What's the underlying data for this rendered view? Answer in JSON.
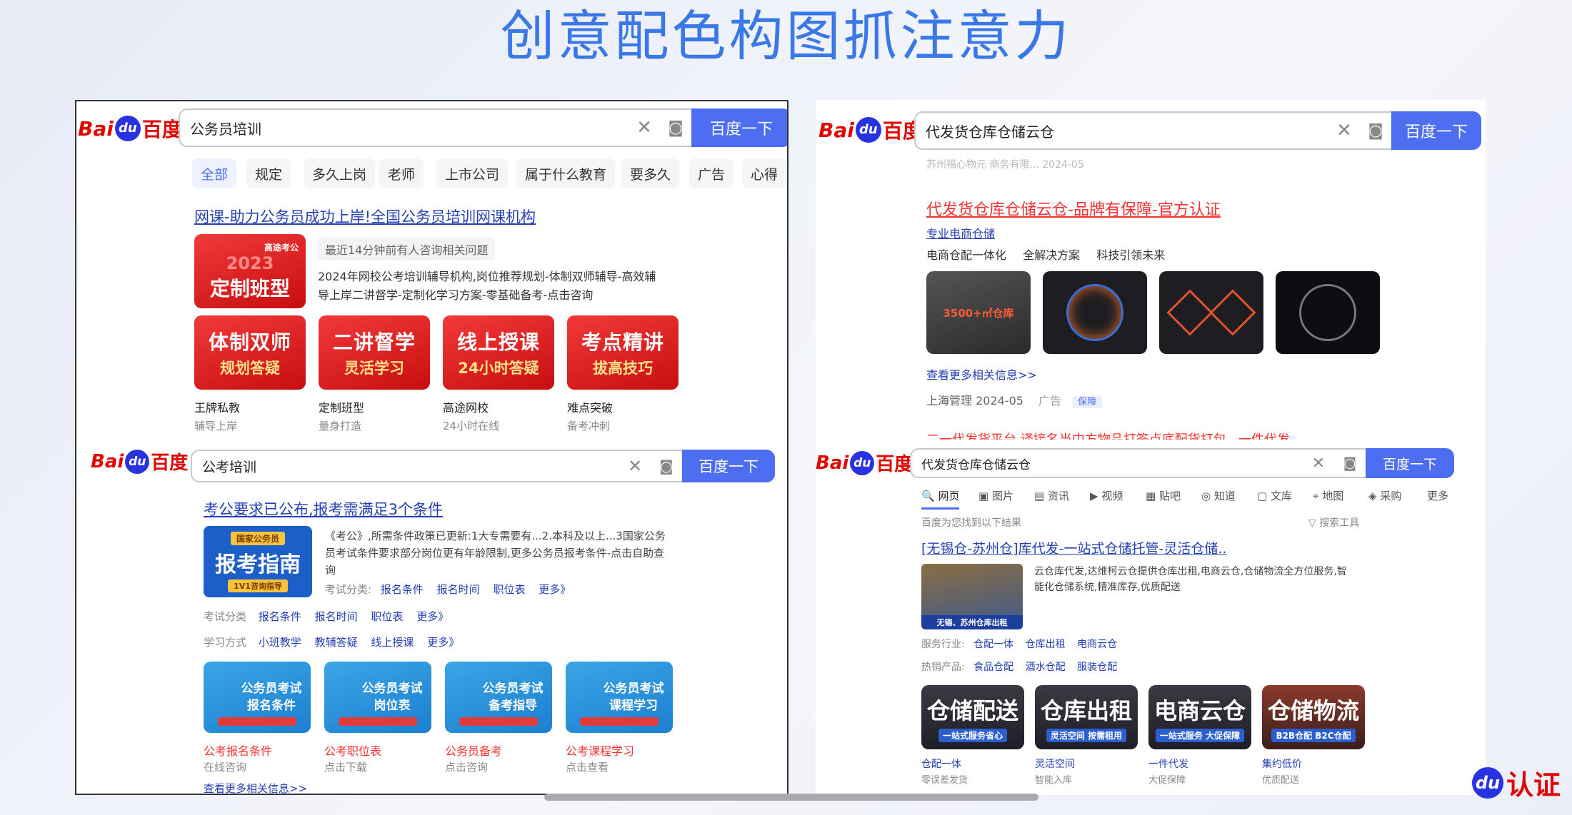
{
  "slide": {
    "title": "创意配色构图抓注意力",
    "watermark": "认证"
  },
  "brand": {
    "bai": "Bai",
    "du": "du",
    "baidu": "百度"
  },
  "search_button": "百度一下",
  "tl": {
    "query": "公务员培训",
    "tabs": [
      "全部",
      "规定",
      "多久上岗",
      "老师",
      "上市公司",
      "属于什么教育",
      "要多久",
      "广告",
      "心得"
    ],
    "title": "网课-助力公务员成功上岸!全国公务员培训网课机构",
    "consult": "最近14分钟前有人咨询相关问题",
    "main_thumb": {
      "top": "高途考公",
      "year": "2023",
      "text": "定制班型"
    },
    "desc1": "2024年网校公考培训辅导机构,岗位推荐规划-体制双师辅导-高效辅",
    "desc2": "导上岸二讲督学-定制化学习方案-零基础备考-点击咨询",
    "cards": [
      {
        "l1": "体制双师",
        "l2": "规划答疑",
        "name": "王牌私教",
        "sub": "辅导上岸"
      },
      {
        "l1": "二讲督学",
        "l2": "灵活学习",
        "name": "定制班型",
        "sub": "量身打造"
      },
      {
        "l1": "线上授课",
        "l2": "24小时答疑",
        "name": "高途网校",
        "sub": "24小时在线"
      },
      {
        "l1": "考点精讲",
        "l2": "拔高技巧",
        "name": "难点突破",
        "sub": "备考冲刺"
      }
    ]
  },
  "bl": {
    "query": "公考培训",
    "title": "考公要求已公布,报考需满足3个条件",
    "guide": {
      "tag": "国家公务员",
      "text": "报考指南",
      "sub": "1V1咨询指导"
    },
    "desc1": "《考公》,所需条件政策已更新:1大专需要有...2.本科及以上...3国家公务",
    "desc2": "员考试条件要求部分岗位更有年龄限制,更多公务员报考条件-点击自助查",
    "desc3": "询",
    "exam_row": {
      "label": "考试分类:",
      "items": [
        "报名条件",
        "报名时间",
        "职位表",
        "更多》"
      ]
    },
    "row2": {
      "label": "考试分类",
      "items": [
        "报名条件",
        "报名时间",
        "职位表",
        "更多》"
      ]
    },
    "row3": {
      "label": "学习方式",
      "items": [
        "小班教学",
        "教辅答疑",
        "线上授课",
        "更多》"
      ]
    },
    "cards": [
      {
        "l1": "公务员考试",
        "l2": "报名条件",
        "name": "公考报名条件",
        "sub": "在线咨询"
      },
      {
        "l1": "公务员考试",
        "l2": "岗位表",
        "name": "公考职位表",
        "sub": "点击下载"
      },
      {
        "l1": "公务员考试",
        "l2": "备考指导",
        "name": "公务员备考",
        "sub": "点击咨询"
      },
      {
        "l1": "公务员考试",
        "l2": "课程学习",
        "name": "公考课程学习",
        "sub": "点击查看"
      }
    ],
    "more": "查看更多相关信息>>"
  },
  "tr": {
    "query": "代发货仓库仓储云仓",
    "cut_text": "苏州福心物元 商务有限... 2024-05",
    "title": "代发货仓库仓储云仓-品牌有保障-官方认证",
    "sub": "专业电商仓储",
    "tags": [
      "电商仓配一体化",
      "全解决方案",
      "科技引领未来"
    ],
    "thumb1": "3500+㎡仓库",
    "more": "查看更多相关信息>>",
    "source": "上海管理 2024-05",
    "ad": "广告",
    "bao": "保障",
    "bottom_cut": "二一代发货平台 译接名当中方物品打签点底配货打包...一件代发"
  },
  "br": {
    "query": "代发货仓库仓储云仓",
    "nav": [
      "网页",
      "图片",
      "资讯",
      "视频",
      "贴吧",
      "知道",
      "文库",
      "地图",
      "采购",
      "更多"
    ],
    "found": "百度为您找到以下结果",
    "tools": "搜索工具",
    "title": "[无锡仓-苏州仓]库代发-一站式仓储托管-灵活仓储..",
    "desc1": "云仓库代发,达维柯云仓提供仓库出租,电商云仓,仓储物流全方位服务,智",
    "desc2": "能化仓储系统,精准库存,优质配送",
    "thumb_text": "无锡、苏州仓库出租",
    "service": {
      "label": "服务行业:",
      "items": [
        "仓配一体",
        "仓库出租",
        "电商云仓"
      ]
    },
    "hot": {
      "label": "热销产品:",
      "items": [
        "食品仓配",
        "酒水仓配",
        "服装仓配"
      ]
    },
    "cards": [
      {
        "big": "仓储配送",
        "small": "一站式服务省心",
        "name": "仓配一体",
        "sub": "零误差发货"
      },
      {
        "big": "仓库出租",
        "small": "灵活空间 按需租用",
        "name": "灵活空间",
        "sub": "智能入库"
      },
      {
        "big": "电商云仓",
        "small": "一站式服务 大促保障",
        "name": "一件代发",
        "sub": "大促保障"
      },
      {
        "big": "仓储物流",
        "small": "B2B仓配 B2C仓配",
        "name": "集约低价",
        "sub": "优质配送"
      }
    ]
  }
}
